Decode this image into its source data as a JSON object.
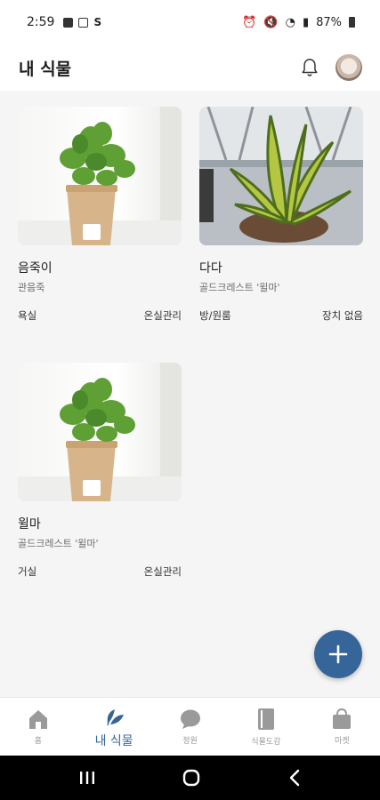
{
  "status_bar": {
    "time": "2:59",
    "battery": "87%"
  },
  "header": {
    "title": "내 식물",
    "icons": [
      "bell-icon",
      "avatar"
    ]
  },
  "plants": [
    {
      "name": "음죽이",
      "species": "관음죽",
      "location": "욕실",
      "device": "온실관리",
      "photo": "potted-plant"
    },
    {
      "name": "다다",
      "species": "골드크레스트 '윌마'",
      "location": "방/원룸",
      "device": "장치 없음",
      "photo": "snake-plant"
    },
    {
      "name": "윌마",
      "species": "골드크레스트 '윌마'",
      "location": "거실",
      "device": "온실관리",
      "photo": "potted-plant"
    }
  ],
  "fab": {
    "icon": "plus-icon",
    "color": "#36659a"
  },
  "bottom_nav": {
    "items": [
      {
        "label": "홈",
        "icon": "home-icon",
        "active": false
      },
      {
        "label": "내 식물",
        "icon": "leaf-icon",
        "active": true
      },
      {
        "label": "정원",
        "icon": "chat-icon",
        "active": false
      },
      {
        "label": "식물도감",
        "icon": "book-icon",
        "active": false
      },
      {
        "label": "마켓",
        "icon": "bag-icon",
        "active": false
      }
    ]
  },
  "colors": {
    "accent": "#36659a",
    "inactive": "#9a9a9a"
  }
}
